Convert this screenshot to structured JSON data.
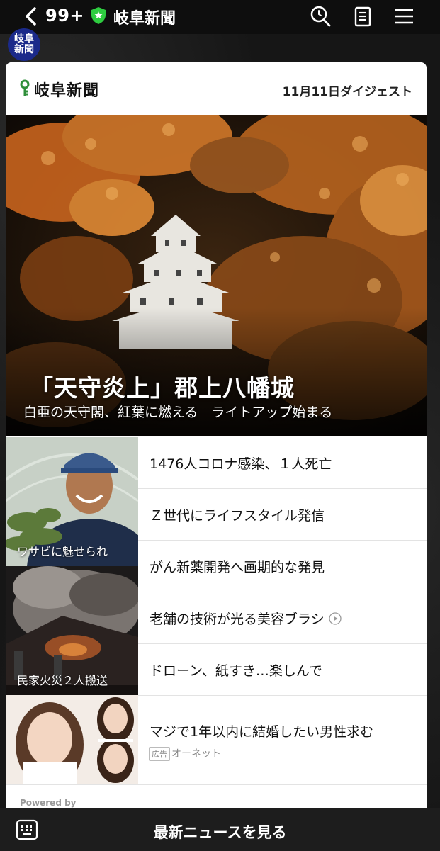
{
  "topbar": {
    "unread_count": "99+",
    "chat_title": "岐阜新聞",
    "icons": [
      "back-chevron-icon",
      "verified-shield-icon",
      "search-icon",
      "notes-icon",
      "menu-icon"
    ]
  },
  "avatar": {
    "text": "岐阜新聞"
  },
  "card": {
    "brand": "岐阜新聞",
    "digest_label": "11月11日ダイジェスト",
    "hero": {
      "title": "「天守炎上」郡上八幡城",
      "subtitle": "白亜の天守閣、紅葉に燃える　ライトアップ始まる"
    },
    "thumbnails": [
      {
        "caption": "ワサビに魅せられ"
      },
      {
        "caption": "民家火災２人搬送"
      }
    ],
    "headlines": [
      {
        "text": "1476人コロナ感染、１人死亡"
      },
      {
        "text": "Ｚ世代にライフスタイル発信"
      },
      {
        "text": "がん新薬開発へ画期的な発見"
      },
      {
        "text": "老舗の技術が光る美容ブラシ",
        "has_video": true
      },
      {
        "text": "ドローン、紙すき…楽しんで"
      }
    ],
    "ad": {
      "title": "マジで1年以内に結婚したい男性求む",
      "badge": "広告",
      "sponsor": "オーネット"
    },
    "powered_by": "Powered by"
  },
  "bottombar": {
    "label": "最新ニュースを見る",
    "icon": "keyboard-icon"
  },
  "colors": {
    "brand_green": "#2f8f3a",
    "shield_green": "#2ecc40",
    "topbar_bg": "#0e0e0e"
  }
}
